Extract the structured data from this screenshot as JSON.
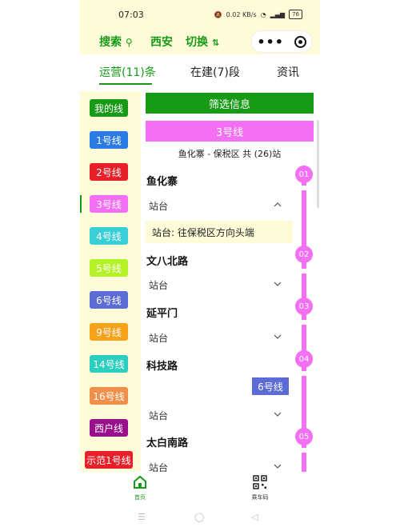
{
  "status_bar": {
    "time": "07:03",
    "speed": "0.02 KB/s",
    "battery": "76"
  },
  "header": {
    "search_label": "搜索",
    "city": "西安",
    "switch_label": "切换"
  },
  "tabs": [
    {
      "label": "运营(11)条",
      "active": true
    },
    {
      "label": "在建(7)段",
      "active": false
    },
    {
      "label": "资讯",
      "active": false
    }
  ],
  "sidebar": {
    "items": [
      {
        "label": "我的线",
        "color": "#179b17"
      },
      {
        "label": "1号线",
        "color": "#2a7be6"
      },
      {
        "label": "2号线",
        "color": "#e8202a"
      },
      {
        "label": "3号线",
        "color": "#f36ff3",
        "active": true
      },
      {
        "label": "4号线",
        "color": "#39cfd9"
      },
      {
        "label": "5号线",
        "color": "#b5f227"
      },
      {
        "label": "6号线",
        "color": "#5b6cd6"
      },
      {
        "label": "9号线",
        "color": "#f7a21b"
      },
      {
        "label": "14号线",
        "color": "#2ccfbf"
      },
      {
        "label": "16号线",
        "color": "#f0904a"
      },
      {
        "label": "西户线",
        "color": "#9a0f8c"
      },
      {
        "label": "示范1号线",
        "color": "#e8202a"
      }
    ]
  },
  "main": {
    "filter_label": "筛选信息",
    "line_name": "3号线",
    "range_text": "鱼化寨 - 保税区 共 (26)站",
    "platform_label": "站台",
    "stations": [
      {
        "index": "01",
        "name": "鱼化寨",
        "expanded": true,
        "detail": "站台: 往保税区方向头端"
      },
      {
        "index": "02",
        "name": "文八北路",
        "expanded": false
      },
      {
        "index": "03",
        "name": "延平门",
        "expanded": false
      },
      {
        "index": "04",
        "name": "科技路",
        "expanded": false,
        "transfer": "6号线"
      },
      {
        "index": "05",
        "name": "太白南路",
        "expanded": false
      }
    ]
  },
  "bottom_nav": {
    "home_label": "首页",
    "ride_code_label": "乘车码"
  },
  "colors": {
    "accent": "#179b17",
    "line3": "#f36ff3",
    "background": "#fefbd8"
  }
}
